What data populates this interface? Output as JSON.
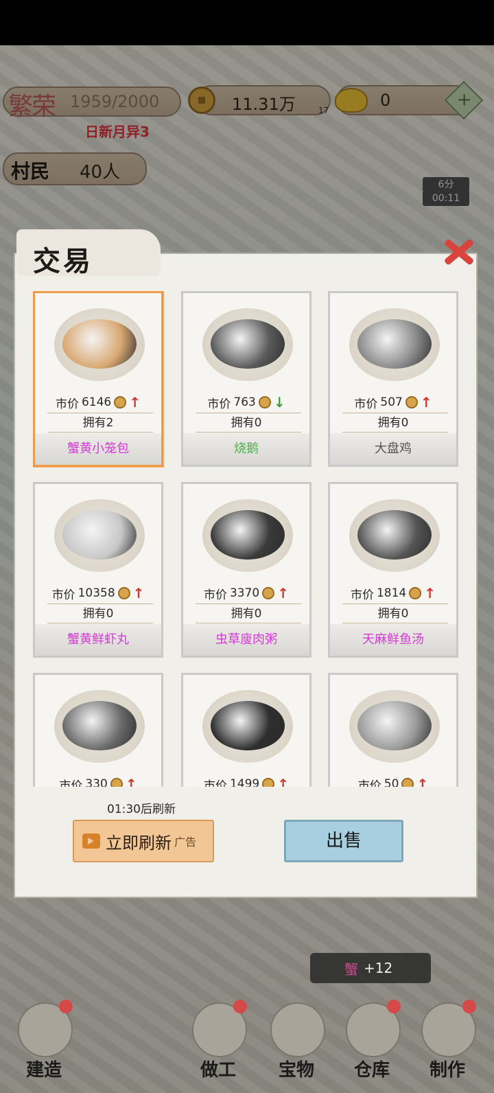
{
  "hud": {
    "prosperity_label": "繁荣",
    "prosperity_value": "1959/2000",
    "prosperity_sub": "日新月异3",
    "coins": "11.31万",
    "coins_badge": "17",
    "ingots": "0",
    "plus": "+",
    "villagers_label": "村民",
    "villagers_value": "40人",
    "timer_small": "6分",
    "timer_clock": "00:11"
  },
  "modal": {
    "title": "交易",
    "price_label": "市价",
    "owned_label": "拥有",
    "items": [
      {
        "name": "蟹黄小笼包",
        "price": "6146",
        "trend": "up",
        "owned": "2",
        "name_color": "#d63ad6",
        "selected": true,
        "food": "#d9a872"
      },
      {
        "name": "烧鹅",
        "price": "763",
        "trend": "down",
        "owned": "0",
        "name_color": "#4fb04f",
        "selected": false,
        "food": "#5a5a5a"
      },
      {
        "name": "大盘鸡",
        "price": "507",
        "trend": "up",
        "owned": "0",
        "name_color": "#555555",
        "selected": false,
        "food": "#8a8a8a"
      },
      {
        "name": "蟹黄鲜虾丸",
        "price": "10358",
        "trend": "up",
        "owned": "0",
        "name_color": "#d63ad6",
        "selected": false,
        "food": "#c8c8c8"
      },
      {
        "name": "虫草廋肉粥",
        "price": "3370",
        "trend": "up",
        "owned": "0",
        "name_color": "#d63ad6",
        "selected": false,
        "food": "#3a3a3a"
      },
      {
        "name": "天麻鲜鱼汤",
        "price": "1814",
        "trend": "up",
        "owned": "0",
        "name_color": "#d63ad6",
        "selected": false,
        "food": "#555555"
      },
      {
        "name": "",
        "price": "330",
        "trend": "up",
        "owned": "",
        "name_color": "#555555",
        "selected": false,
        "food": "#6a6a6a"
      },
      {
        "name": "",
        "price": "1499",
        "trend": "up",
        "owned": "",
        "name_color": "#555555",
        "selected": false,
        "food": "#2e2e2e"
      },
      {
        "name": "",
        "price": "50",
        "trend": "up",
        "owned": "",
        "name_color": "#555555",
        "selected": false,
        "food": "#9a9a9a"
      }
    ],
    "refresh_timer": "01:30后刷新",
    "refresh_button": "立即刷新",
    "ad_label": "广告",
    "sell_button": "出售"
  },
  "notice": {
    "item": "蟹",
    "amount": "+12"
  },
  "nav": [
    {
      "label": "建造",
      "dot": true
    },
    {
      "label": "做工",
      "dot": true
    },
    {
      "label": "宝物",
      "dot": false
    },
    {
      "label": "仓库",
      "dot": true
    },
    {
      "label": "制作",
      "dot": true
    }
  ]
}
